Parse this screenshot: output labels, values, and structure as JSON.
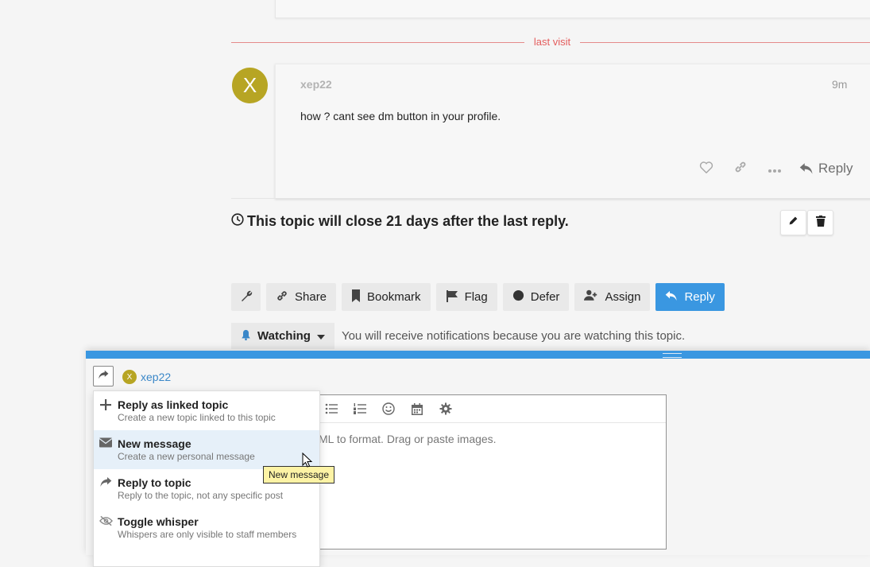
{
  "last_visit": {
    "label": "last visit"
  },
  "post": {
    "avatar_letter": "X",
    "username": "xep22",
    "time": "9m",
    "body": "how ? cant see dm button in your profile.",
    "reply_label": "Reply"
  },
  "close_notice": "This topic will close 21 days after the last reply.",
  "topic_footer": {
    "share": "Share",
    "bookmark": "Bookmark",
    "flag": "Flag",
    "defer": "Defer",
    "assign": "Assign",
    "reply": "Reply"
  },
  "notifications": {
    "level": "Watching",
    "text": "You will receive notifications because you are watching this topic."
  },
  "composer": {
    "user_letter": "X",
    "username": "xep22",
    "placeholder_visible": "ML to format. Drag or paste images."
  },
  "reply_menu": [
    {
      "title": "Reply as linked topic",
      "desc": "Create a new topic linked to this topic",
      "icon": "plus-icon"
    },
    {
      "title": "New message",
      "desc": "Create a new personal message",
      "icon": "envelope-icon"
    },
    {
      "title": "Reply to topic",
      "desc": "Reply to the topic, not any specific post",
      "icon": "share-icon"
    },
    {
      "title": "Toggle whisper",
      "desc": "Whispers are only visible to staff members",
      "icon": "eye-slash-icon"
    }
  ],
  "tooltip": "New message",
  "colors": {
    "accent": "#3a97e1",
    "avatar": "#b7a524",
    "last_visit": "#e45d5d",
    "highlight": "#e6f0f9"
  }
}
